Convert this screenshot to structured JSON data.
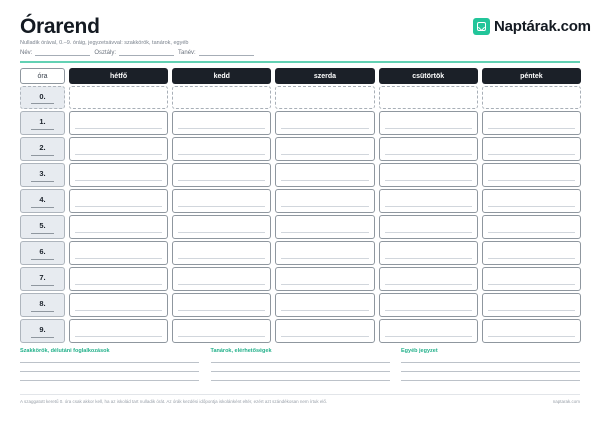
{
  "header": {
    "title": "Órarend",
    "subtitle": "Nulladik órával, 0.–9. óráig, jegyzetsávval: szakkörök, tanárok, egyéb",
    "fields": [
      {
        "label": "Név:"
      },
      {
        "label": "Osztály:"
      },
      {
        "label": "Tanév:"
      }
    ],
    "brand": {
      "name": "Naptárak.com",
      "icon": "calendar-check-icon",
      "color": "#22c59a"
    }
  },
  "timetable": {
    "corner_label": "óra",
    "days": [
      "hétfő",
      "kedd",
      "szerda",
      "csütörtök",
      "péntek"
    ],
    "periods": [
      "0.",
      "1.",
      "2.",
      "3.",
      "4.",
      "5.",
      "6.",
      "7.",
      "8.",
      "9."
    ]
  },
  "notes": [
    {
      "title": "Szakkörök, délutáni foglalkozások"
    },
    {
      "title": "Tanárok, elérhetőségek"
    },
    {
      "title": "Egyéb jegyzet"
    }
  ],
  "footer": {
    "left": "A szaggatott keretű 0. óra csak akkor kell, ha az iskolád tart nulladik órát. Az órák kezdési időpontja iskolánként eltér, ezért azt szándékosan nem írtuk elő.",
    "right": "naptarak.com"
  },
  "colors": {
    "accent": "#22c59a",
    "header_dark": "#1b2028"
  }
}
